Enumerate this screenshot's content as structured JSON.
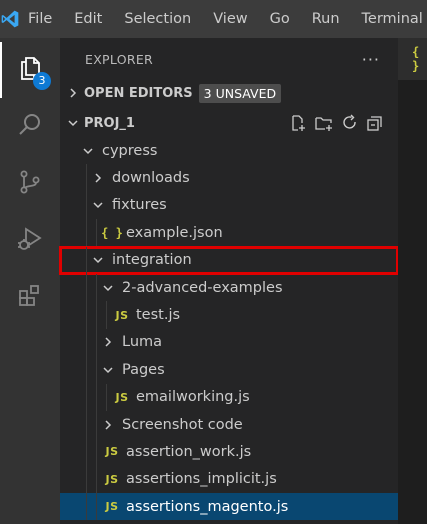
{
  "menubar": {
    "items": [
      "File",
      "Edit",
      "Selection",
      "View",
      "Go",
      "Run",
      "Terminal"
    ]
  },
  "activitybar": {
    "explorer_badge": "3"
  },
  "sidebar": {
    "title": "EXPLORER",
    "more_label": "···",
    "open_editors": {
      "label": "OPEN EDITORS",
      "badge": "3 UNSAVED"
    },
    "project": {
      "label": "PROJ_1"
    },
    "tree": [
      {
        "label": "cypress",
        "kind": "folder-open",
        "depth": 0
      },
      {
        "label": "downloads",
        "kind": "folder-closed",
        "depth": 1
      },
      {
        "label": "fixtures",
        "kind": "folder-open",
        "depth": 1
      },
      {
        "label": "example.json",
        "kind": "json",
        "depth": 2
      },
      {
        "label": "integration",
        "kind": "folder-open",
        "depth": 1,
        "highlight": true
      },
      {
        "label": "2-advanced-examples",
        "kind": "folder-open",
        "depth": 2
      },
      {
        "label": "test.js",
        "kind": "js",
        "depth": 3
      },
      {
        "label": "Luma",
        "kind": "folder-closed",
        "depth": 2
      },
      {
        "label": "Pages",
        "kind": "folder-open",
        "depth": 2
      },
      {
        "label": "emailworking.js",
        "kind": "js",
        "depth": 3
      },
      {
        "label": "Screenshot code",
        "kind": "folder-closed",
        "depth": 2
      },
      {
        "label": "assertion_work.js",
        "kind": "js",
        "depth": 2
      },
      {
        "label": "assertions_implicit.js",
        "kind": "js",
        "depth": 2
      },
      {
        "label": "assertions_magento.js",
        "kind": "js",
        "depth": 2,
        "selected": true
      }
    ],
    "icons": {
      "json": "{ }",
      "js": "JS"
    }
  },
  "editor": {
    "tab_icon": "{ }"
  }
}
